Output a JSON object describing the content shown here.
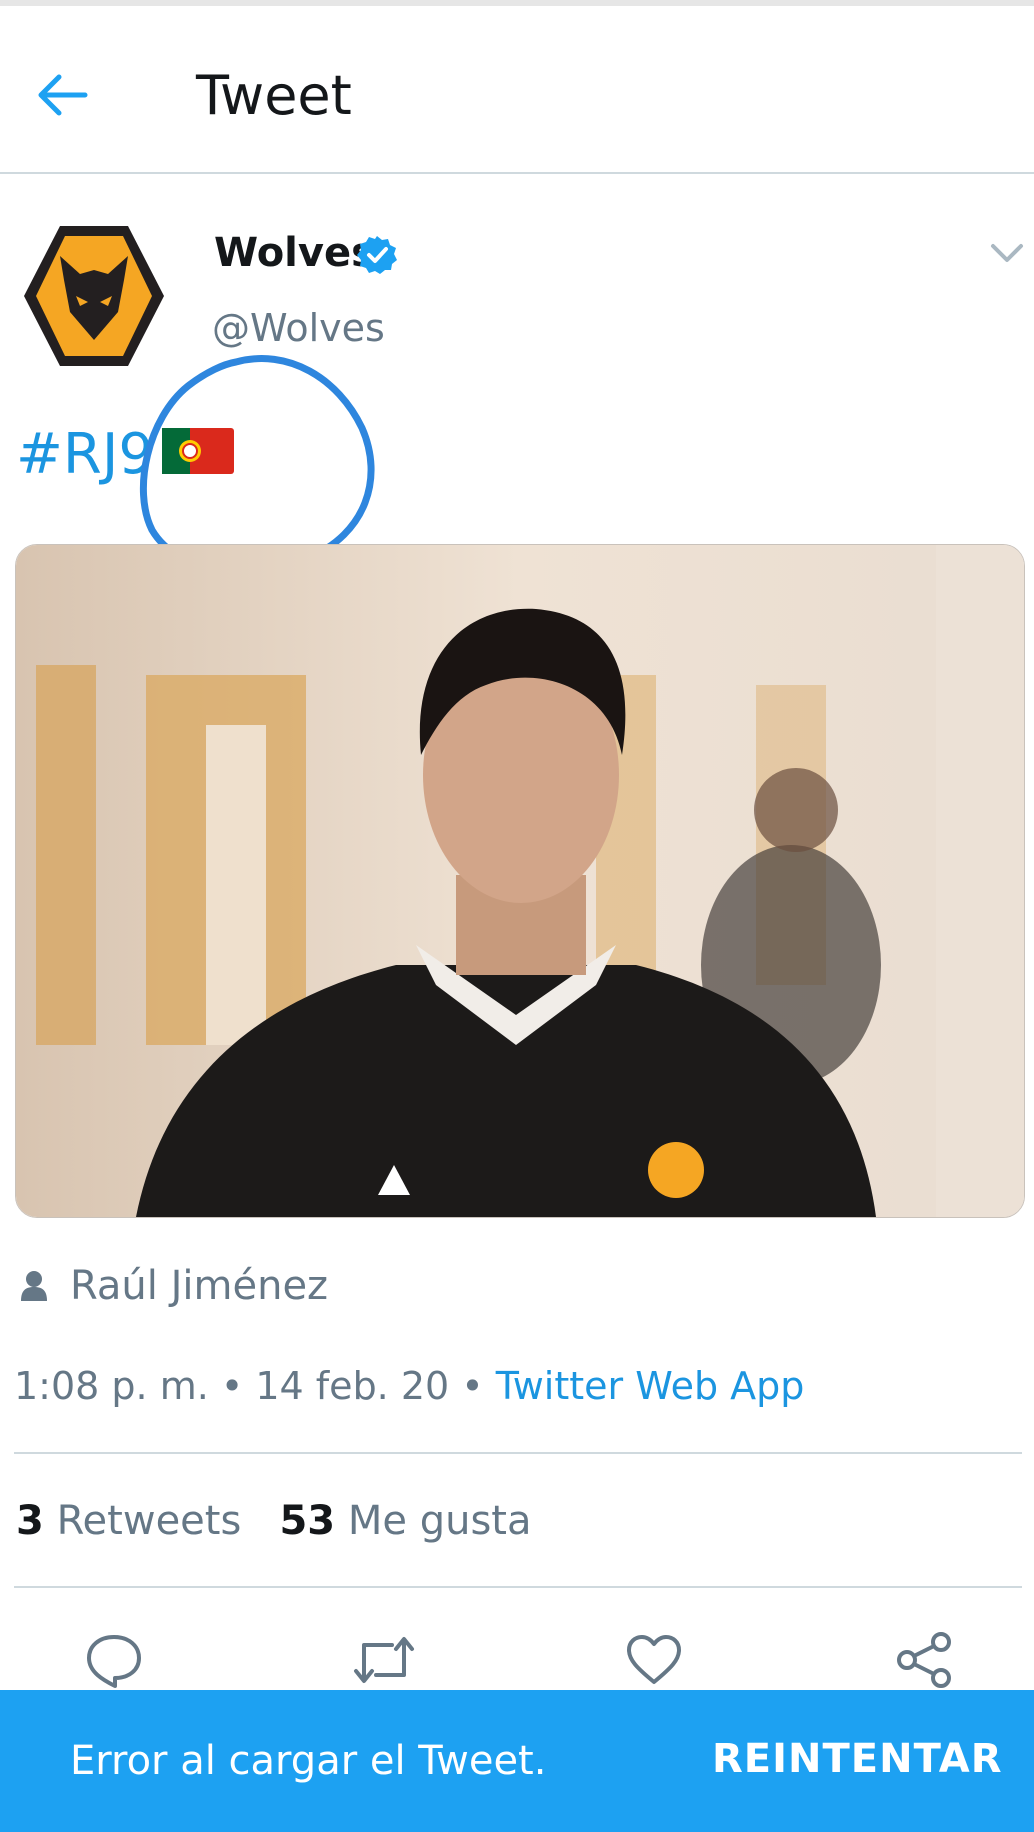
{
  "header": {
    "title": "Tweet"
  },
  "tweet": {
    "author_name": "Wolves",
    "author_handle": "@Wolves",
    "text": "#RJ9",
    "tagged_person": "Raúl Jiménez",
    "time": "1:08 p. m.",
    "date": "14 feb. 20",
    "separator": " • ",
    "source": "Twitter Web App",
    "retweets_count": "3",
    "retweets_label": "Retweets",
    "likes_count": "53",
    "likes_label": "Me gusta"
  },
  "snackbar": {
    "message": "Error al cargar el Tweet.",
    "action": "REINTENTAR"
  },
  "colors": {
    "accent": "#1da1f2",
    "link": "#1b95e0",
    "muted_text": "#657786",
    "annotation_circle": "#2e86de",
    "wolves_gold": "#f5a623"
  },
  "icons": [
    "back-arrow-icon",
    "verified-badge-icon",
    "chevron-down-icon",
    "person-icon",
    "reply-icon",
    "retweet-icon",
    "like-icon",
    "share-icon",
    "portugal-flag-icon"
  ]
}
